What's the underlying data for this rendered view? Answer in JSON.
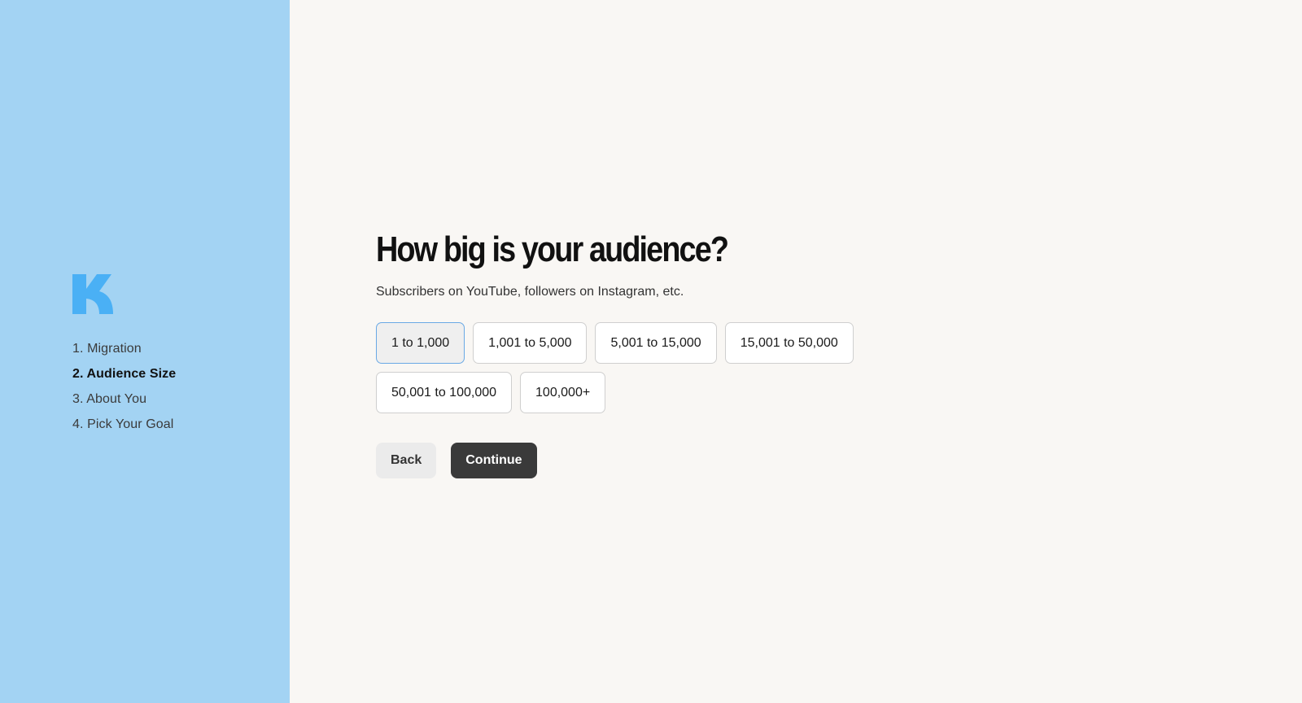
{
  "brand": {
    "logo_icon": "brand-k-logo-icon",
    "accent": "#4ab0f5"
  },
  "colors": {
    "sidebar_bg": "#a3d3f3",
    "page_bg": "#f9f7f4",
    "selected_border": "#6aa9e5",
    "primary_button": "#3a3a3a"
  },
  "sidebar": {
    "steps": [
      {
        "label": "1. Migration",
        "active": false
      },
      {
        "label": "2. Audience Size",
        "active": true
      },
      {
        "label": "3. About You",
        "active": false
      },
      {
        "label": "4. Pick Your Goal",
        "active": false
      }
    ]
  },
  "main": {
    "title": "How big is your audience?",
    "subtitle": "Subscribers on YouTube, followers on Instagram, etc.",
    "options": [
      {
        "label": "1 to 1,000",
        "selected": true
      },
      {
        "label": "1,001 to 5,000",
        "selected": false
      },
      {
        "label": "5,001 to 15,000",
        "selected": false
      },
      {
        "label": "15,001 to 50,000",
        "selected": false
      },
      {
        "label": "50,001 to 100,000",
        "selected": false
      },
      {
        "label": "100,000+",
        "selected": false
      }
    ],
    "back_label": "Back",
    "continue_label": "Continue"
  }
}
